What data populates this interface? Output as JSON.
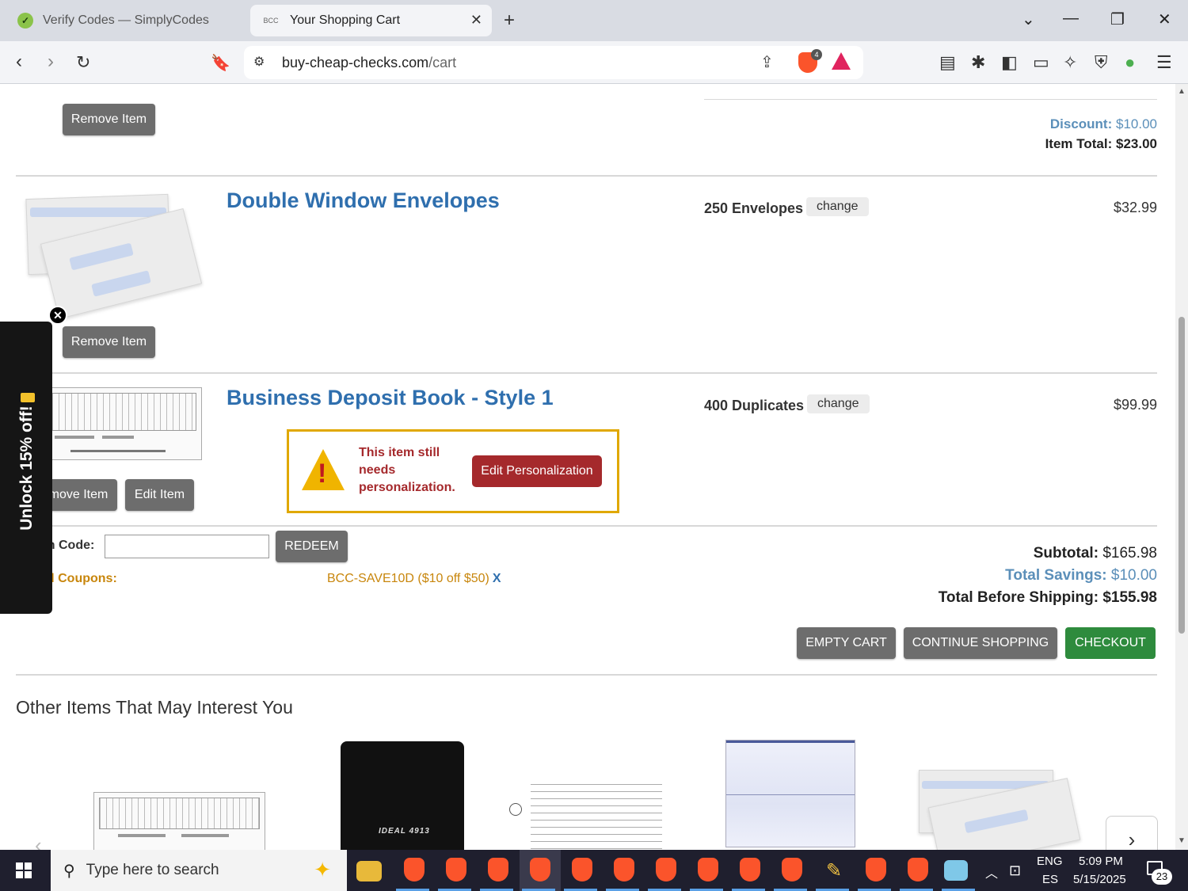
{
  "browser": {
    "tabs": [
      {
        "title": "Verify Codes — SimplyCodes",
        "favicon": "simplycodes-icon"
      },
      {
        "title": "Your Shopping Cart",
        "favicon_text": "BCC"
      }
    ],
    "url_domain": "buy-cheap-checks.com",
    "url_path": "/cart",
    "brave_shield_count": "4"
  },
  "cart": {
    "prev_item": {
      "remove_label": "Remove Item",
      "discount_label": "Discount:",
      "discount_value": "$10.00",
      "total_label": "Item Total:",
      "total_value": "$23.00"
    },
    "items": [
      {
        "title": "Double Window Envelopes",
        "qty": "250 Envelopes",
        "change_label": "change",
        "price": "$32.99",
        "remove_label": "Remove Item"
      },
      {
        "title": "Business Deposit Book - Style 1",
        "qty": "400 Duplicates",
        "change_label": "change",
        "price": "$99.99",
        "remove_label": "move Item",
        "edit_label": "Edit Item",
        "warning_text": "This item still needs personalization.",
        "edit_personalization_label": "Edit Personalization"
      }
    ],
    "coupon": {
      "label": "on Code:",
      "redeem_label": "REDEEM",
      "applied_label": "ed Coupons:",
      "applied_code": "BCC-SAVE10D ($10 off $50)",
      "remove_x": "X"
    },
    "summary": {
      "subtotal_label": "Subtotal:",
      "subtotal_value": "$165.98",
      "savings_label": "Total Savings:",
      "savings_value": "$10.00",
      "before_shipping_label": "Total Before Shipping:",
      "before_shipping_value": "$155.98"
    },
    "actions": {
      "empty": "EMPTY CART",
      "continue": "CONTINUE SHOPPING",
      "checkout": "CHECKOUT"
    }
  },
  "recommendations": {
    "heading": "Other Items That May Interest You",
    "stamp_label": "IDEAL 4913",
    "next": "›",
    "prev": "‹"
  },
  "promo": {
    "text": "Unlock 15% off!"
  },
  "taskbar": {
    "search_placeholder": "Type here to search",
    "lang_top": "ENG",
    "lang_bottom": "ES",
    "time": "5:09 PM",
    "date": "5/15/2025",
    "notifications": "23"
  },
  "colors": {
    "title_blue": "#2f6fae",
    "warning_red": "#a5292c",
    "warning_border": "#e0a800",
    "checkout_green": "#2e8b3d",
    "coupon_orange": "#c8860c"
  }
}
